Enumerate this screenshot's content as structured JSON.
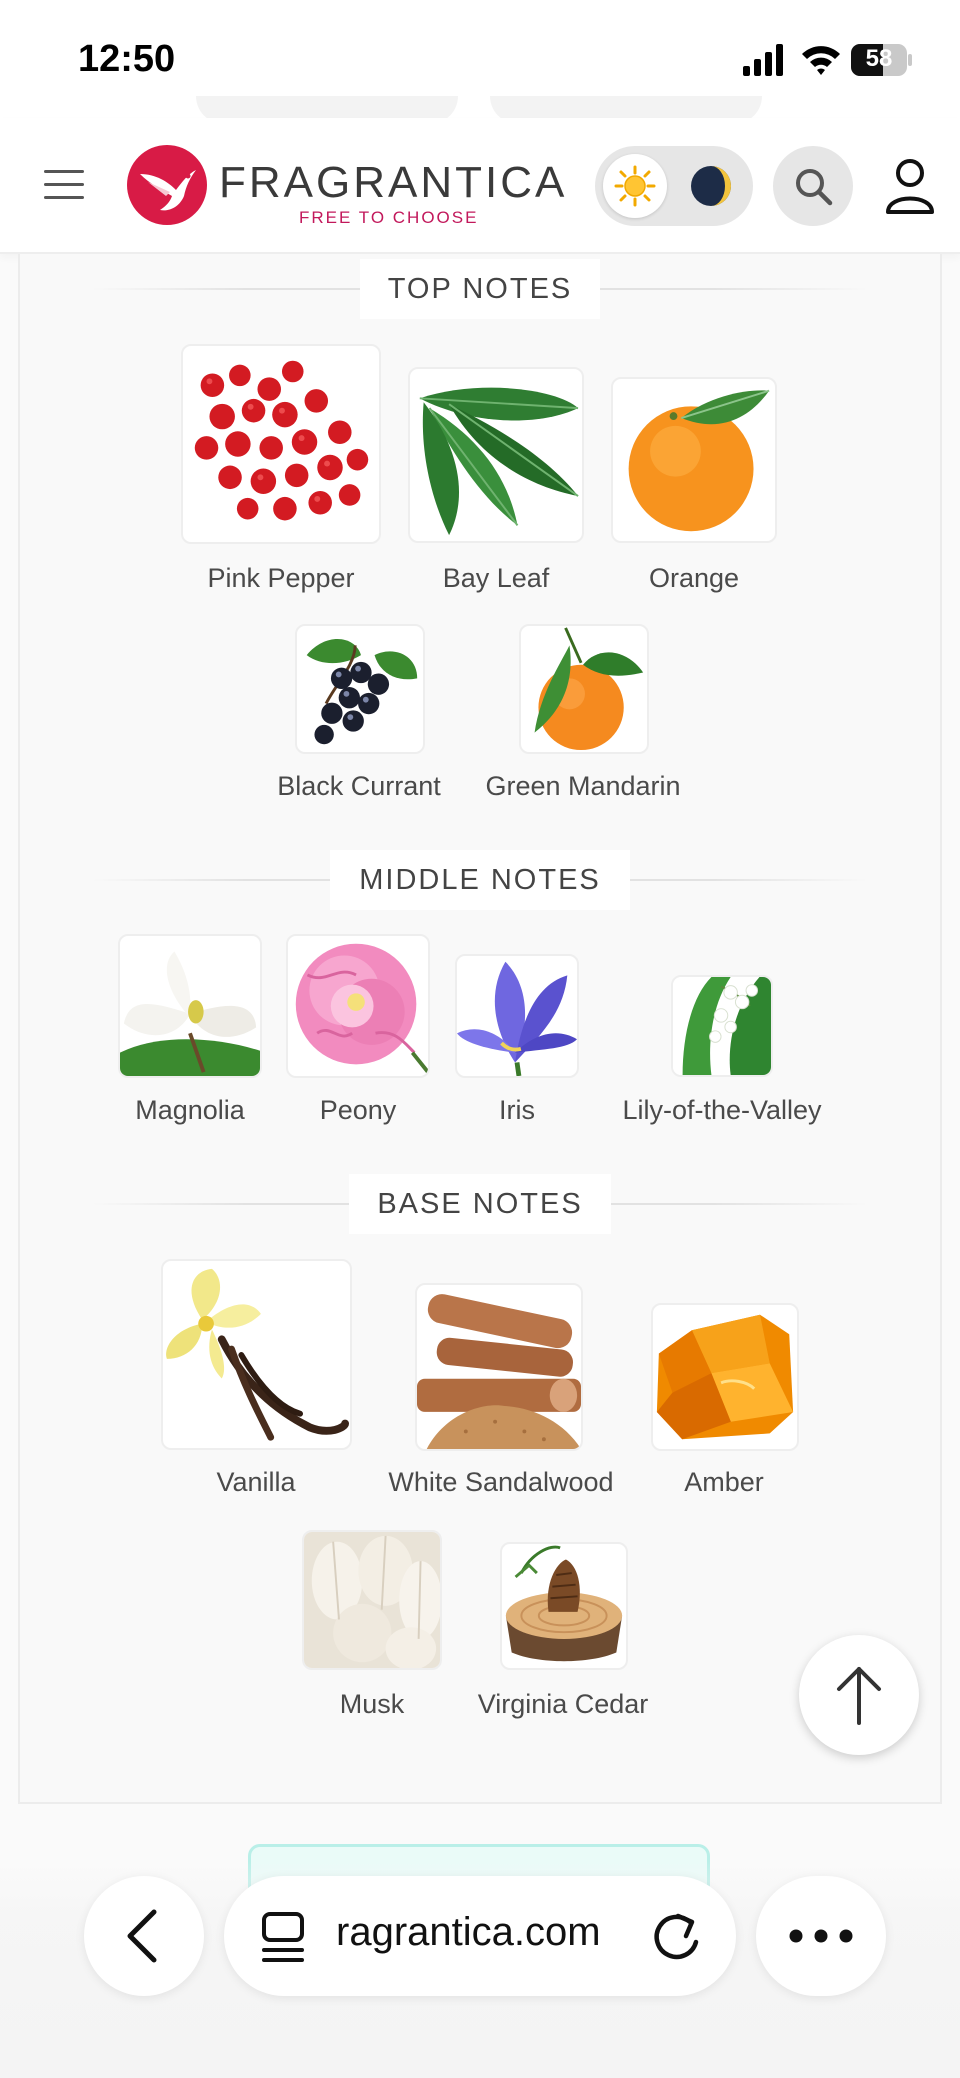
{
  "status_bar": {
    "time": "12:50",
    "battery_level": "58",
    "battery_fraction": 0.58
  },
  "header": {
    "brand_name": "FRAGRANTICA",
    "tagline": "FREE TO CHOOSE",
    "brand_color": "#d81b46",
    "icons": [
      "menu-icon",
      "hummingbird-logo-icon",
      "sun-icon",
      "moon-icon",
      "search-icon",
      "user-icon"
    ]
  },
  "sections": {
    "top": {
      "title": "TOP NOTES",
      "notes": [
        {
          "label": "Pink Pepper",
          "icon": "pink-pepper-icon"
        },
        {
          "label": "Bay Leaf",
          "icon": "bay-leaf-icon"
        },
        {
          "label": "Orange",
          "icon": "orange-icon"
        },
        {
          "label": "Black Currant",
          "icon": "black-currant-icon"
        },
        {
          "label": "Green Mandarin",
          "icon": "green-mandarin-icon"
        }
      ]
    },
    "middle": {
      "title": "MIDDLE NOTES",
      "notes": [
        {
          "label": "Magnolia",
          "icon": "magnolia-icon"
        },
        {
          "label": "Peony",
          "icon": "peony-icon"
        },
        {
          "label": "Iris",
          "icon": "iris-icon"
        },
        {
          "label": "Lily-of-the-Valley",
          "icon": "lily-of-the-valley-icon"
        }
      ]
    },
    "base": {
      "title": "BASE NOTES",
      "notes": [
        {
          "label": "Vanilla",
          "icon": "vanilla-icon"
        },
        {
          "label": "White Sandalwood",
          "icon": "sandalwood-icon"
        },
        {
          "label": "Amber",
          "icon": "amber-icon"
        },
        {
          "label": "Musk",
          "icon": "musk-icon"
        },
        {
          "label": "Virginia Cedar",
          "icon": "cedar-icon"
        }
      ]
    }
  },
  "browser": {
    "url": "ragrantica.com",
    "icons": [
      "back-icon",
      "tabs-icon",
      "reload-icon",
      "more-icon",
      "arrow-up-icon"
    ]
  }
}
